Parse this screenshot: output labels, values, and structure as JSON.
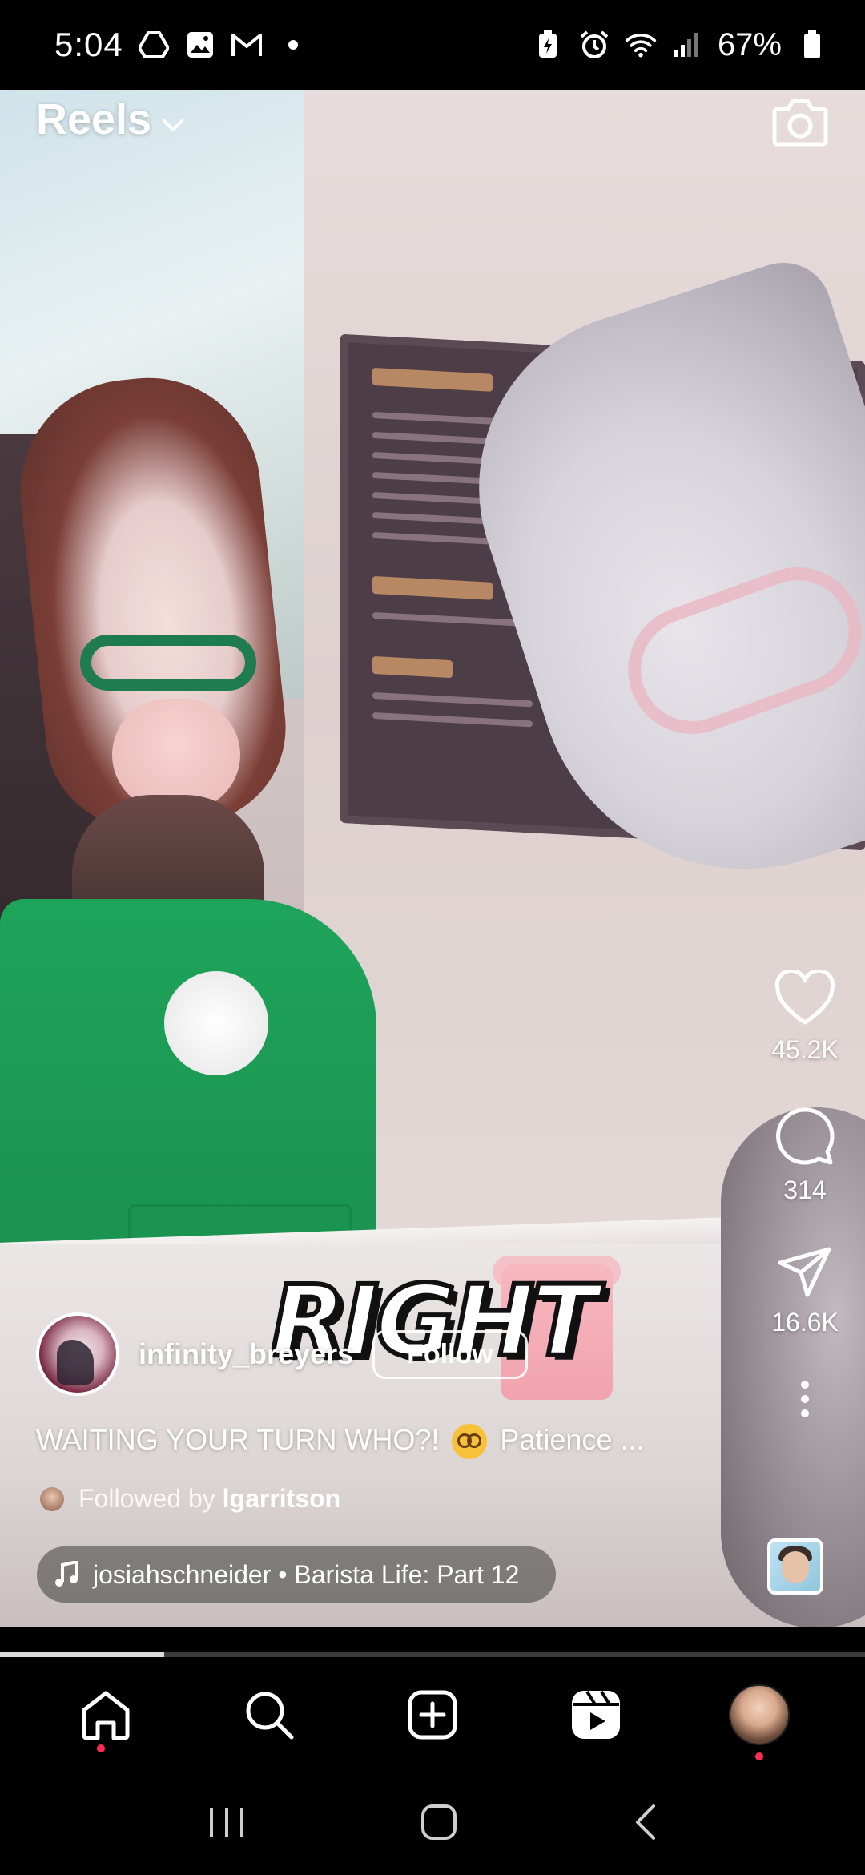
{
  "status_bar": {
    "time": "5:04",
    "battery": "67%",
    "left_icons": [
      "drive-icon",
      "image-icon",
      "gmail-icon",
      "dot-icon"
    ],
    "right_icons": [
      "battery-saver-icon",
      "alarm-icon",
      "wifi-icon",
      "signal-icon",
      "battery-icon"
    ]
  },
  "header": {
    "title": "Reels",
    "camera_icon": "camera-icon"
  },
  "overlay_sticker": {
    "text": "RIGHT"
  },
  "actions": {
    "likes": "45.2K",
    "comments": "314",
    "shares": "16.6K"
  },
  "author": {
    "username": "infinity_breyers",
    "follow_label": "Follow"
  },
  "caption": {
    "text_before": "WAITING YOUR TURN WHO?! ",
    "emoji_name": "dizzy-face-emoji",
    "text_after": " Patience ..."
  },
  "followed_by": {
    "prefix": "Followed by",
    "user": "lgarritson"
  },
  "audio": {
    "text": "josiahschneider • Barista Life: Part 12"
  },
  "playback": {
    "progress": 0.19
  },
  "bottom_nav": {
    "items": [
      "home-icon",
      "search-icon",
      "create-icon",
      "reels-icon",
      "profile-avatar"
    ]
  },
  "system_nav": {
    "items": [
      "recent-apps-icon",
      "home-button-icon",
      "back-icon"
    ]
  },
  "colors": {
    "notification_dot": "#ff2b55",
    "apron_green": "#1ea45a"
  }
}
